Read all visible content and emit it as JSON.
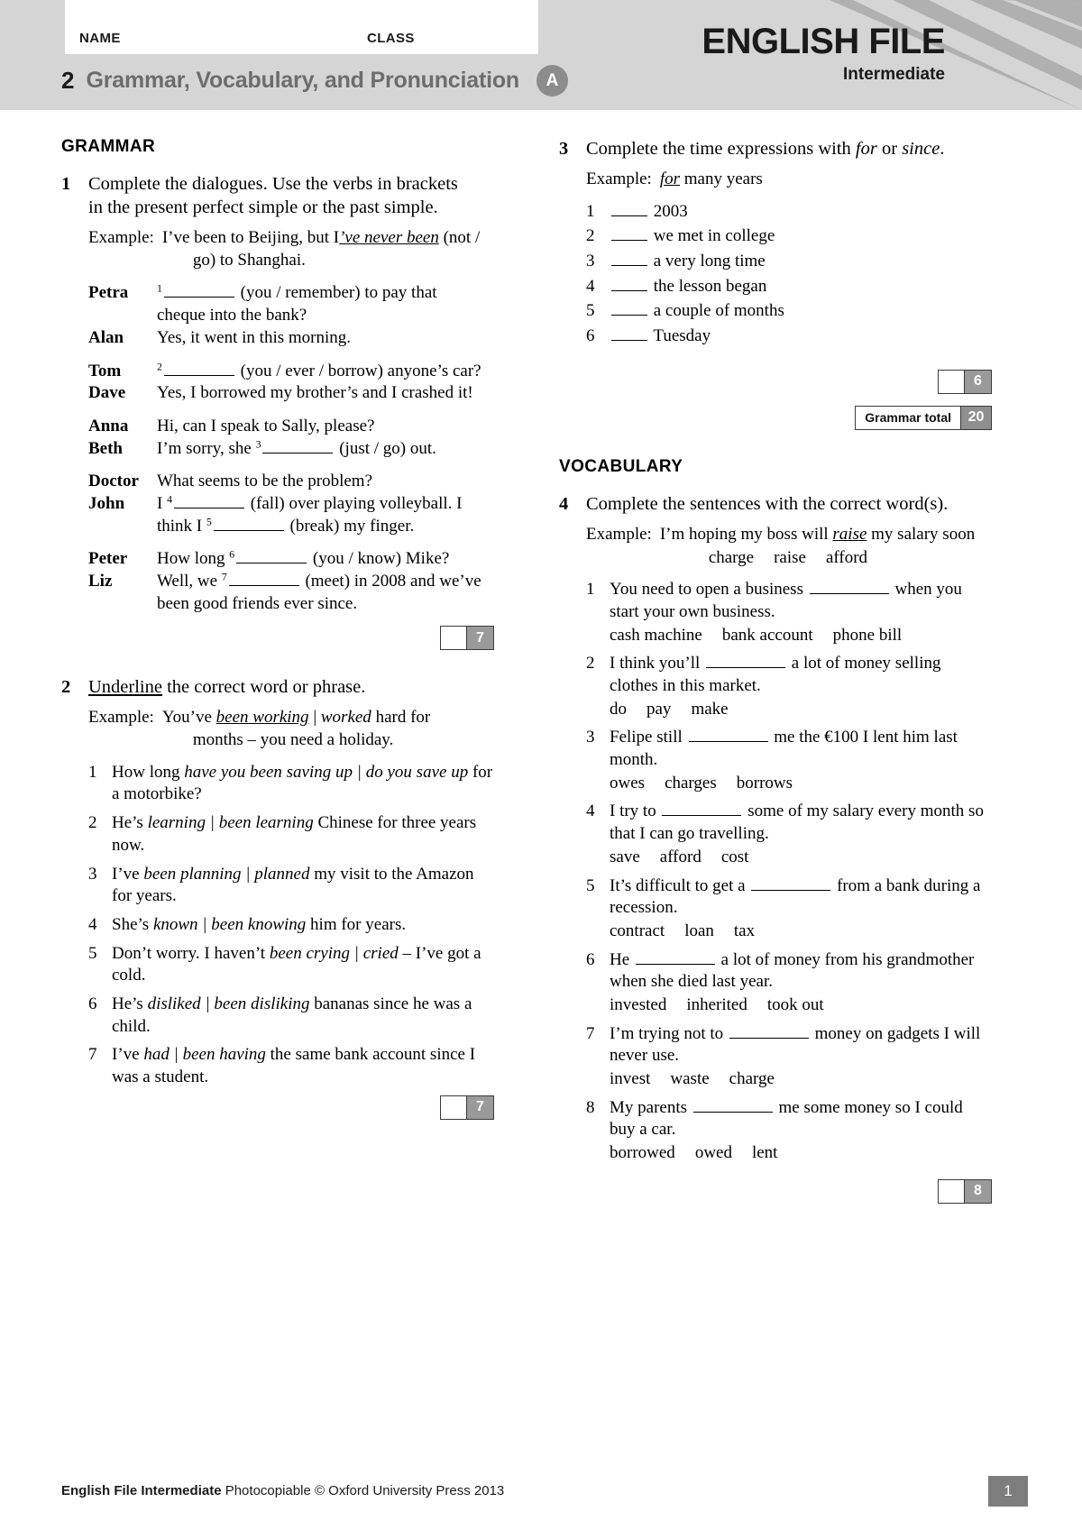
{
  "header": {
    "name_label": "NAME",
    "class_label": "CLASS",
    "unit_number": "2",
    "unit_title": "Grammar, Vocabulary, and Pronunciation",
    "version_letter": "A",
    "brand_title": "ENGLISH FILE",
    "brand_level": "Intermediate"
  },
  "grammar": {
    "section_title": "GRAMMAR",
    "ex1": {
      "number": "1",
      "instruction_a": "Complete the dialogues. Use the verbs in brackets",
      "instruction_b": "in the present perfect simple or the past simple.",
      "example_label": "Example:",
      "example_pre": "I’ve been to Beijing, but I",
      "example_answer": "’ve never been",
      "example_post": "(not /",
      "example_line2": "go) to Shanghai.",
      "dialogues": [
        {
          "lines": [
            {
              "speaker": "Petra",
              "sup": "1",
              "pre": "",
              "post": "(you / remember) to pay that",
              "line2": "cheque into the bank?"
            },
            {
              "speaker": "Alan",
              "sup": "",
              "pre": "Yes, it went in this morning.",
              "post": "",
              "line2": ""
            }
          ]
        },
        {
          "lines": [
            {
              "speaker": "Tom",
              "sup": "2",
              "pre": "",
              "post": "(you / ever / borrow) anyone’s car?",
              "line2": ""
            },
            {
              "speaker": "Dave",
              "sup": "",
              "pre": "Yes, I borrowed my brother’s and I crashed it!",
              "post": "",
              "line2": ""
            }
          ]
        },
        {
          "lines": [
            {
              "speaker": "Anna",
              "sup": "",
              "pre": "Hi, can I speak to Sally, please?",
              "post": "",
              "line2": ""
            },
            {
              "speaker": "Beth",
              "sup": "3",
              "pre": "I’m sorry, she",
              "post": "(just / go) out.",
              "line2": ""
            }
          ]
        },
        {
          "lines": [
            {
              "speaker": "Doctor",
              "sup": "",
              "pre": "What seems to be the problem?",
              "post": "",
              "line2": ""
            },
            {
              "speaker": "John",
              "sup": "4",
              "pre": "I",
              "post": "(fall) over playing volleyball. I",
              "line2": "",
              "sup2": "5",
              "pre2": "think I",
              "post2": "(break) my finger."
            }
          ]
        },
        {
          "lines": [
            {
              "speaker": "Peter",
              "sup": "6",
              "pre": "How long",
              "post": "(you / know) Mike?",
              "line2": ""
            },
            {
              "speaker": "Liz",
              "sup": "7",
              "pre": "Well, we",
              "post": "(meet) in 2008 and we’ve",
              "line2": "been good friends ever since."
            }
          ]
        }
      ],
      "score": "7"
    },
    "ex2": {
      "number": "2",
      "instruction_underlined": "Underline",
      "instruction_rest": "the correct word or phrase.",
      "example_label": "Example:",
      "example_pre": "You’ve ",
      "example_answer": "been working",
      "example_mid": " | ",
      "example_alt": "worked",
      "example_post": " hard for",
      "example_line2": "months – you need a holiday.",
      "items": [
        {
          "n": "1",
          "pre": "How long ",
          "opt_a": "have you been saving up",
          "opt_b": "do you save up",
          "post": " for a motorbike?"
        },
        {
          "n": "2",
          "pre": "He’s ",
          "opt_a": "learning",
          "opt_b": "been learning",
          "post": " Chinese for three years now."
        },
        {
          "n": "3",
          "pre": "I’ve ",
          "opt_a": "been planning",
          "opt_b": "planned",
          "post": " my visit to the Amazon for years."
        },
        {
          "n": "4",
          "pre": "She’s ",
          "opt_a": "known",
          "opt_b": "been knowing",
          "post": " him for years."
        },
        {
          "n": "5",
          "pre": "Don’t worry. I haven’t ",
          "opt_a": "been crying",
          "opt_b": "cried",
          "post": " – I’ve got a cold."
        },
        {
          "n": "6",
          "pre": "He’s ",
          "opt_a": "disliked",
          "opt_b": "been disliking",
          "post": " bananas since he was a child."
        },
        {
          "n": "7",
          "pre": "I’ve ",
          "opt_a": "had",
          "opt_b": "been having",
          "post": " the same bank account since I was a student."
        }
      ],
      "score": "7"
    },
    "ex3": {
      "number": "3",
      "instruction_pre": "Complete the time expressions with ",
      "instruction_it1": "for",
      "instruction_mid": " or ",
      "instruction_it2": "since",
      "instruction_post": ".",
      "example_label": "Example:",
      "example_answer": "for",
      "example_rest": "many years",
      "items": [
        {
          "n": "1",
          "text": "2003"
        },
        {
          "n": "2",
          "text": "we met in college"
        },
        {
          "n": "3",
          "text": "a very long time"
        },
        {
          "n": "4",
          "text": "the lesson began"
        },
        {
          "n": "5",
          "text": "a couple of months"
        },
        {
          "n": "6",
          "text": "Tuesday"
        }
      ],
      "score": "6"
    },
    "total_label": "Grammar total",
    "total_value": "20"
  },
  "vocabulary": {
    "section_title": "VOCABULARY",
    "ex4": {
      "number": "4",
      "instruction": "Complete the sentences with the correct word(s).",
      "example_label": "Example:",
      "example_pre": "I’m hoping my boss will ",
      "example_answer": "raise",
      "example_post": " my salary soon",
      "example_options": [
        "charge",
        "raise",
        "afford"
      ],
      "items": [
        {
          "n": "1",
          "pre": "You need to open a business ",
          "post": " when you start your own business.",
          "options": [
            "cash machine",
            "bank account",
            "phone bill"
          ]
        },
        {
          "n": "2",
          "pre": "I think you’ll ",
          "post": " a lot of money selling clothes in this market.",
          "options": [
            "do",
            "pay",
            "make"
          ]
        },
        {
          "n": "3",
          "pre": "Felipe still ",
          "post": " me the €100 I lent him last month.",
          "options": [
            "owes",
            "charges",
            "borrows"
          ]
        },
        {
          "n": "4",
          "pre": "I try to ",
          "post": " some of my salary every month so that I can go travelling.",
          "options": [
            "save",
            "afford",
            "cost"
          ]
        },
        {
          "n": "5",
          "pre": "It’s difficult to get a ",
          "post": " from a bank during a recession.",
          "options": [
            "contract",
            "loan",
            "tax"
          ]
        },
        {
          "n": "6",
          "pre": "He ",
          "post": " a lot of money from his grandmother when she died last year.",
          "options": [
            "invested",
            "inherited",
            "took out"
          ]
        },
        {
          "n": "7",
          "pre": "I’m trying not to ",
          "post": " money on gadgets I will never use.",
          "options": [
            "invest",
            "waste",
            "charge"
          ]
        },
        {
          "n": "8",
          "pre": "My parents ",
          "post": " me some money so I could buy a car.",
          "options": [
            "borrowed",
            "owed",
            "lent"
          ]
        }
      ],
      "score": "8"
    }
  },
  "footer": {
    "title_bold": "English File Intermediate",
    "rest": " Photocopiable © Oxford University Press 2013",
    "page_number": "1"
  }
}
